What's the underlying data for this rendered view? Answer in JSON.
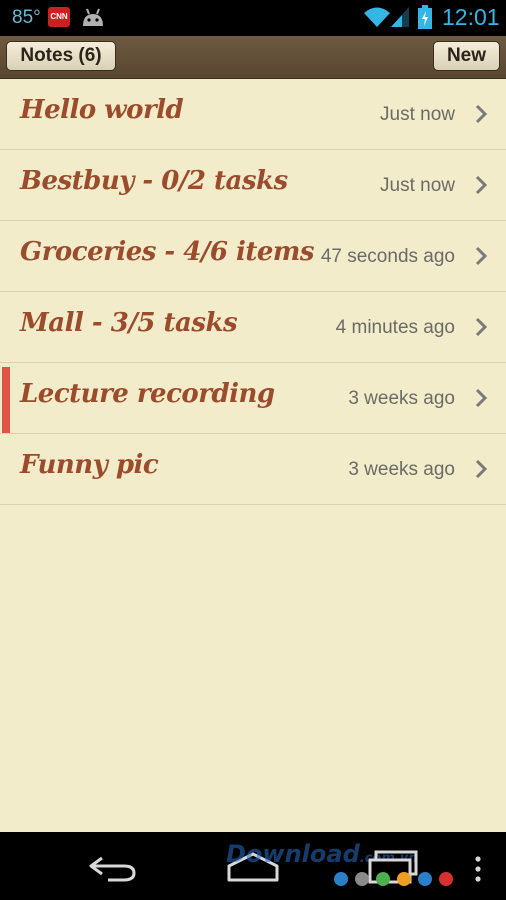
{
  "status_bar": {
    "temperature": "85°",
    "time": "12:01",
    "icons": [
      "cnn-icon",
      "android-icon",
      "wifi-icon",
      "signal-icon",
      "battery-icon"
    ],
    "cnn_text": "CNN"
  },
  "action_bar": {
    "notes_label": "Notes (6)",
    "new_label": "New"
  },
  "notes": [
    {
      "title": "Hello world",
      "time": "Just now"
    },
    {
      "title": "Bestbuy - 0/2 tasks",
      "time": "Just now"
    },
    {
      "title": "Groceries - 4/6 items",
      "time": "47 seconds ago"
    },
    {
      "title": "Mall - 3/5 tasks",
      "time": "4 minutes ago"
    },
    {
      "title": "Lecture recording",
      "time": "3 weeks ago",
      "marked": true
    },
    {
      "title": "Funny pic",
      "time": "3 weeks ago"
    }
  ],
  "nav_bar": {
    "icons": [
      "back-icon",
      "home-icon",
      "recents-icon",
      "menu-icon"
    ]
  },
  "watermark": {
    "text": "Download",
    "suffix": ".com.vn",
    "dot_colors": [
      "#2a7fc9",
      "#8a8a8a",
      "#4caf50",
      "#f0a020",
      "#2a7fc9",
      "#d83030"
    ]
  },
  "colors": {
    "background": "#f2eccb",
    "note_title": "#9b4c2c",
    "action_bar": "#5f4c36",
    "marker": "#e05548",
    "status_accent": "#33b5e5"
  }
}
